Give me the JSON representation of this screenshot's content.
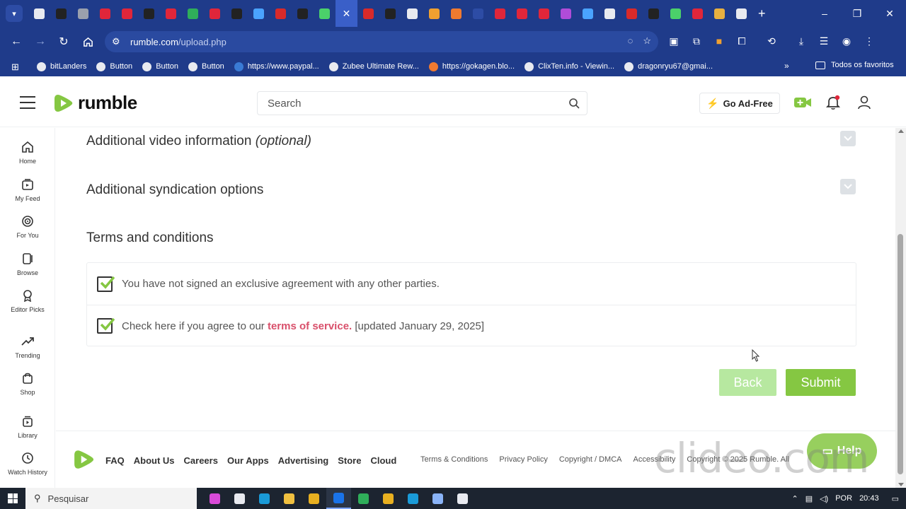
{
  "browser": {
    "tabs_dropdown_icon": "chevron-down-icon",
    "tab_colors": [
      "#e8eaf0",
      "#222222",
      "#9aa0ad",
      "#e0263a",
      "#e0263a",
      "#222222",
      "#e0263a",
      "#2fae5a",
      "#e0263a",
      "#222222",
      "#4aa3ff",
      "#d82a2a",
      "#222222",
      "#4bd16a"
    ],
    "tab_colors_after": [
      "#d82a2a",
      "#222222",
      "#e8eaf0",
      "#f0a030",
      "#f07a30",
      "#2d4ca5",
      "#e0263a",
      "#e0263a",
      "#e0263a",
      "#b04cd8",
      "#4aa3ff",
      "#e8eaf0",
      "#d82a2a",
      "#222222",
      "#4bd16a",
      "#e0263a",
      "#e8b040",
      "#e8eaf0"
    ],
    "active_tab_icon": "✕",
    "new_tab": "+",
    "window_controls": [
      "–",
      "❐",
      "✕"
    ],
    "url_host": "rumble.com",
    "url_path": "/upload.php",
    "bookmarks": [
      {
        "label": "bitLanders",
        "color": "#e8eaf0"
      },
      {
        "label": "Button",
        "color": "#e8eaf0"
      },
      {
        "label": "Button",
        "color": "#e8eaf0"
      },
      {
        "label": "Button",
        "color": "#e8eaf0"
      },
      {
        "label": "https://www.paypal...",
        "color": "#3a7bd5"
      },
      {
        "label": "Zubee Ultimate Rew...",
        "color": "#e8eaf0"
      },
      {
        "label": "https://gokagen.blo...",
        "color": "#f07a30"
      },
      {
        "label": "ClixTen.info - Viewin...",
        "color": "#e8eaf0"
      },
      {
        "label": "dragonryu67@gmai...",
        "color": "#e8eaf0"
      }
    ],
    "bookmarks_more": "»",
    "all_bookmarks": "Todos os favoritos"
  },
  "header": {
    "logo_text": "rumble",
    "search_placeholder": "Search",
    "ad_free_label": "Go Ad-Free",
    "brand_green": "#85c742"
  },
  "sidebar": {
    "items": [
      {
        "label": "Home",
        "icon": "home-icon"
      },
      {
        "label": "My Feed",
        "icon": "feed-icon"
      },
      {
        "label": "For You",
        "icon": "target-icon"
      },
      {
        "label": "Browse",
        "icon": "browse-icon"
      },
      {
        "label": "Editor Picks",
        "icon": "award-icon"
      },
      {
        "label": "Trending",
        "icon": "trending-icon"
      },
      {
        "label": "Shop",
        "icon": "shop-icon"
      },
      {
        "label": "Library",
        "icon": "library-icon"
      },
      {
        "label": "Watch History",
        "icon": "history-icon"
      }
    ]
  },
  "main": {
    "additional_info_title": "Additional video information",
    "additional_info_optional": "(optional)",
    "syndication_title": "Additional syndication options",
    "terms_title": "Terms and conditions",
    "terms_row1": "You have not signed an exclusive agreement with any other parties.",
    "terms_row2_prefix": "Check here if you agree to our",
    "terms_row2_link": "terms of service.",
    "terms_row2_suffix": "[updated January 29, 2025]",
    "back_label": "Back",
    "submit_label": "Submit"
  },
  "footer": {
    "links": [
      "FAQ",
      "About Us",
      "Careers",
      "Our Apps",
      "Advertising",
      "Store",
      "Cloud"
    ],
    "legal": [
      "Terms & Conditions",
      "Privacy Policy",
      "Copyright / DMCA",
      "Accessibility",
      "Copyright © 2025 Rumble. All"
    ],
    "help_label": "Help",
    "watermark": "clideo.com"
  },
  "taskbar": {
    "search_placeholder": "Pesquisar",
    "app_colors": [
      "#d84ad8",
      "#e8eaf0",
      "#1a9bd8",
      "#f0c040",
      "#e8b020",
      "#1a73e8",
      "#2fae5a",
      "#e8b020",
      "#1a9bd8",
      "#8ab4f8",
      "#e8eaf0"
    ],
    "language": "POR",
    "time": "20:43"
  }
}
